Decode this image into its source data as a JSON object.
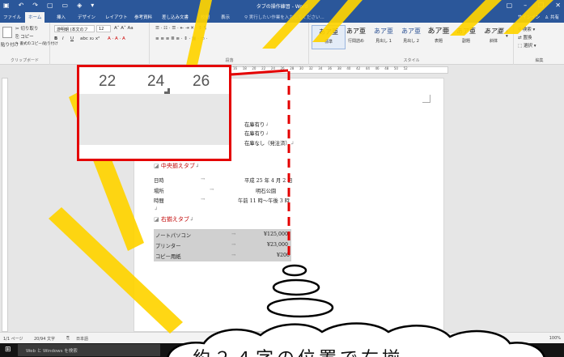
{
  "window": {
    "title": "タブの操作練習 - Word",
    "quick_access_icons": [
      "save-icon",
      "undo-icon",
      "redo-icon",
      "new-icon",
      "open-icon",
      "print-preview-icon",
      "customize-icon"
    ],
    "controls": [
      "ribbon-options-icon",
      "minimize-icon",
      "maximize-icon",
      "close-icon"
    ]
  },
  "tabs": [
    {
      "label": "ファイル",
      "active": false
    },
    {
      "label": "ホーム",
      "active": true
    },
    {
      "label": "挿入",
      "active": false
    },
    {
      "label": "デザイン",
      "active": false
    },
    {
      "label": "レイアウト",
      "active": false
    },
    {
      "label": "参考資料",
      "active": false
    },
    {
      "label": "差し込み文書",
      "active": false
    },
    {
      "label": "校閲",
      "active": false
    },
    {
      "label": "表示",
      "active": false
    }
  ],
  "tell_me": "実行したい作業を入力してください...",
  "account": {
    "signin": "サインイン",
    "share": "共有"
  },
  "ribbon": {
    "clipboard": {
      "paste": "貼り付け",
      "cut": "切り取り",
      "copy": "コピー",
      "format_painter": "書式のコピー/貼り付け",
      "label": "クリップボード"
    },
    "font": {
      "name": "游明朝 (本文のフ",
      "size": "12",
      "bold": "B",
      "italic": "I",
      "underline": "U"
    },
    "paragraph": {
      "label": "段落"
    },
    "styles": {
      "items": [
        {
          "sample": "あア亜",
          "name": "標準",
          "selected": true
        },
        {
          "sample": "あア亜",
          "name": "行間詰め",
          "selected": false
        },
        {
          "sample": "あア亜",
          "name": "見出し 1",
          "selected": false
        },
        {
          "sample": "あア亜",
          "name": "見出し 2",
          "selected": false
        },
        {
          "sample": "あア亜",
          "name": "表題",
          "selected": false
        },
        {
          "sample": "あア亜",
          "name": "副題",
          "selected": false
        },
        {
          "sample": "あア亜",
          "name": "斜体",
          "selected": false
        }
      ],
      "label": "スタイル"
    },
    "editing": {
      "find": "検索",
      "replace": "置換",
      "select": "選択",
      "label": "編集"
    }
  },
  "ruler": {
    "ticks": [
      "16",
      "18",
      "20",
      "22",
      "24",
      "26",
      "28",
      "30",
      "32",
      "34",
      "36",
      "38",
      "40",
      "42",
      "44",
      "46",
      "48",
      "50",
      "52"
    ]
  },
  "document": {
    "left_tab_items": [
      "在庫有り",
      "在庫有り",
      "在庫なし（発注済）"
    ],
    "center_heading": "中央揃えタブ",
    "center_rows": [
      {
        "label": "日時",
        "value": "平成 25 年 4 月 2 日"
      },
      {
        "label": "場所",
        "value": "明石公園"
      },
      {
        "label": "時間",
        "value": "午前 11 時～午後 3 時"
      }
    ],
    "right_heading": "右揃えタブ",
    "right_rows": [
      {
        "item": "ノートパソコン",
        "price": "¥125,000"
      },
      {
        "item": "プリンター",
        "price": "¥23,000"
      },
      {
        "item": "コピー用紙",
        "price": "¥200"
      }
    ],
    "tab_arrow": "→",
    "para_mark": "↲"
  },
  "status": {
    "page": "1/1 ページ",
    "words": "20/94 文字",
    "language": "日本語",
    "zoom": "100%"
  },
  "taskbar": {
    "search_placeholder": "Web と Windows を検索"
  },
  "zoom_box": {
    "labels": [
      "22",
      "24",
      "26"
    ]
  },
  "callout": {
    "text": "約２４字の位置で右揃"
  },
  "overlay_colors": {
    "highlight": "#e40000",
    "watermark": "#ffd400"
  }
}
